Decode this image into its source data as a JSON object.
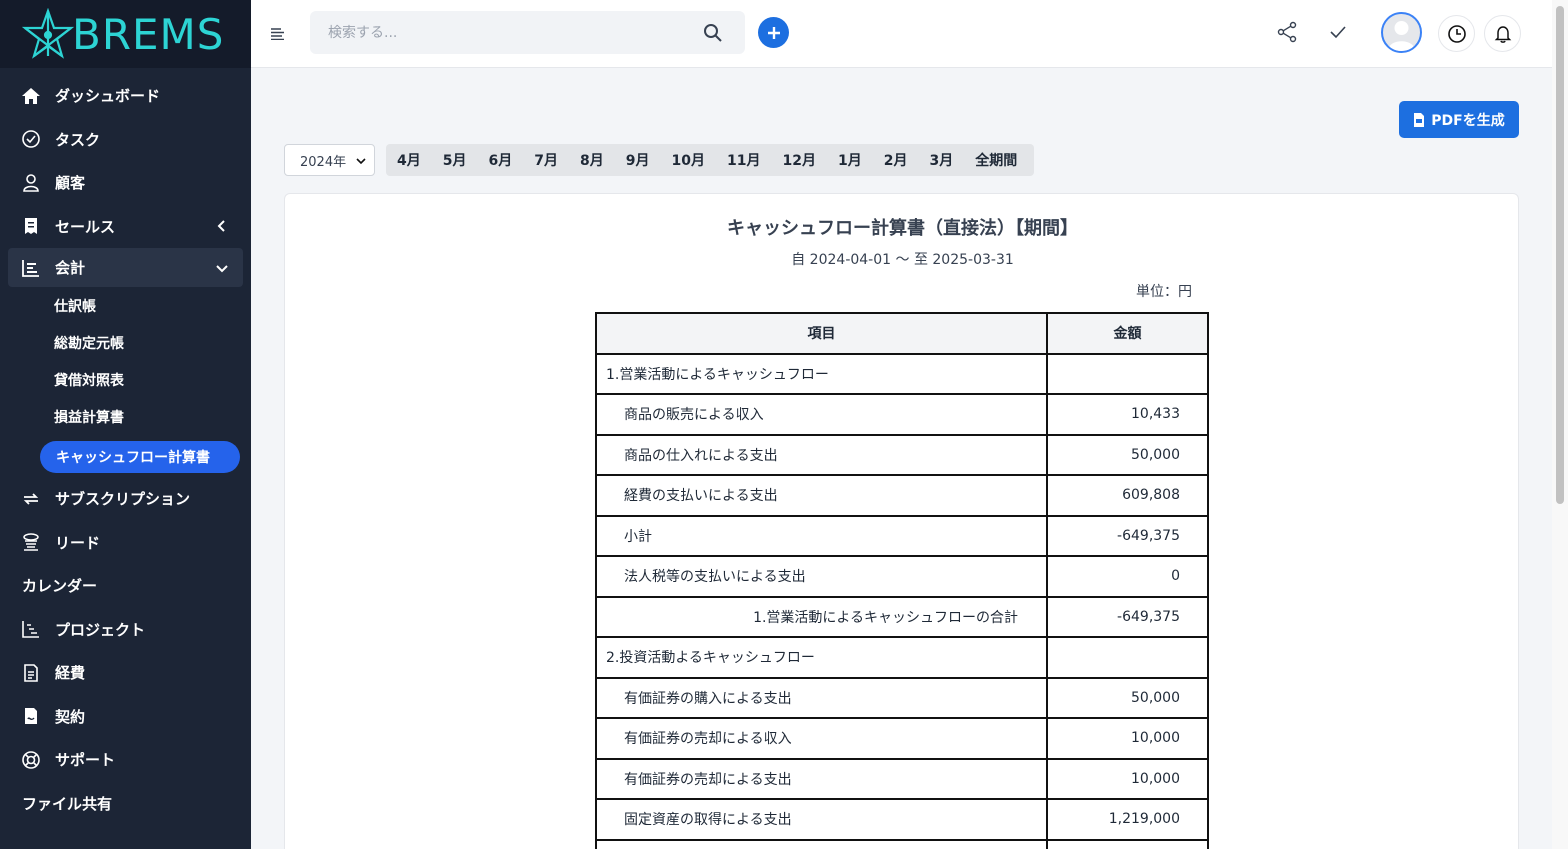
{
  "app": {
    "logo_text": "BREMS"
  },
  "sidebar": {
    "items": [
      {
        "label": "ダッシュボード"
      },
      {
        "label": "タスク"
      },
      {
        "label": "顧客"
      },
      {
        "label": "セールス"
      },
      {
        "label": "会計"
      },
      {
        "label": "サブスクリプション"
      },
      {
        "label": "リード"
      },
      {
        "label": "カレンダー"
      },
      {
        "label": "プロジェクト"
      },
      {
        "label": "経費"
      },
      {
        "label": "契約"
      },
      {
        "label": "サポート"
      },
      {
        "label": "ファイル共有"
      }
    ],
    "accounting_sub": [
      {
        "label": "仕訳帳"
      },
      {
        "label": "総勘定元帳"
      },
      {
        "label": "貸借対照表"
      },
      {
        "label": "損益計算書"
      },
      {
        "label": "キャッシュフロー計算書"
      }
    ]
  },
  "header": {
    "search_placeholder": "検索する..."
  },
  "toolbar": {
    "pdf_label": "PDFを生成",
    "year": "2024年",
    "months": [
      "4月",
      "5月",
      "6月",
      "7月",
      "8月",
      "9月",
      "10月",
      "11月",
      "12月",
      "1月",
      "2月",
      "3月",
      "全期間"
    ]
  },
  "report": {
    "title": "キャッシュフロー計算書（直接法）【期間】",
    "period": "自 2024-04-01 〜 至 2025-03-31",
    "unit": "単位：円",
    "col_item": "項目",
    "col_amount": "金額",
    "rows": [
      {
        "label": "1.営業活動によるキャッシュフロー",
        "amount": ""
      },
      {
        "label": "商品の販売による収入",
        "amount": "10,433"
      },
      {
        "label": "商品の仕入れによる支出",
        "amount": "50,000"
      },
      {
        "label": "経費の支払いによる支出",
        "amount": "609,808"
      },
      {
        "label": "小計",
        "amount": "-649,375"
      },
      {
        "label": "法人税等の支払いによる支出",
        "amount": "0"
      },
      {
        "label": "1.営業活動によるキャッシュフローの合計",
        "amount": "-649,375"
      },
      {
        "label": "2.投資活動よるキャッシュフロー",
        "amount": ""
      },
      {
        "label": "有価証券の購入による支出",
        "amount": "50,000"
      },
      {
        "label": "有価証券の売却による収入",
        "amount": "10,000"
      },
      {
        "label": "有価証券の売却による支出",
        "amount": "10,000"
      },
      {
        "label": "固定資産の取得による支出",
        "amount": "1,219,000"
      },
      {
        "label": "",
        "amount": ""
      }
    ]
  },
  "colors": {
    "sidebar_bg": "#1c2536",
    "accent": "#1d6fe0",
    "logo": "#2dd4d4"
  }
}
